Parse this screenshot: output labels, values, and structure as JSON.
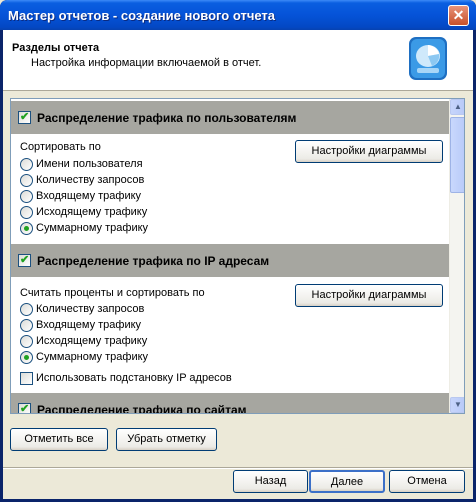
{
  "window": {
    "title": "Мастер отчетов - создание нового отчета",
    "close_glyph": "✕"
  },
  "header": {
    "title": "Разделы отчета",
    "subtitle": "Настройка информации включаемой в отчет."
  },
  "sections": [
    {
      "title": "Распределение трафика по пользователям",
      "checked": true,
      "group_label": "Сортировать по",
      "chart_button": "Настройки диаграммы",
      "options": [
        "Имени пользователя",
        "Количеству запросов",
        "Входящему трафику",
        "Исходящему трафику",
        "Суммарному трафику"
      ],
      "selected": "Суммарному трафику"
    },
    {
      "title": "Распределение трафика по IP адресам",
      "checked": true,
      "group_label": "Считать проценты и сортировать по",
      "chart_button": "Настройки диаграммы",
      "options": [
        "Количеству запросов",
        "Входящему трафику",
        "Исходящему трафику",
        "Суммарному трафику"
      ],
      "selected": "Суммарному трафику",
      "extra_checkbox": {
        "label": "Использовать подстановку IP адресов",
        "checked": false
      }
    },
    {
      "title": "Распределение трафика по сайтам",
      "checked": true
    }
  ],
  "list_buttons": {
    "check_all": "Отметить все",
    "uncheck": "Убрать отметку"
  },
  "footer": {
    "back": "Назад",
    "next": "Далее",
    "cancel": "Отмена"
  },
  "check_glyph": "✔",
  "scroll": {
    "up_glyph": "▲",
    "down_glyph": "▼"
  },
  "colors": {
    "titlebar": "#0553d8",
    "section_bar": "#a6a6a0",
    "radio_selected": "#21a121"
  },
  "icons": [
    "report-wizard-icon",
    "close-icon",
    "scroll-up-icon",
    "scroll-down-icon"
  ]
}
